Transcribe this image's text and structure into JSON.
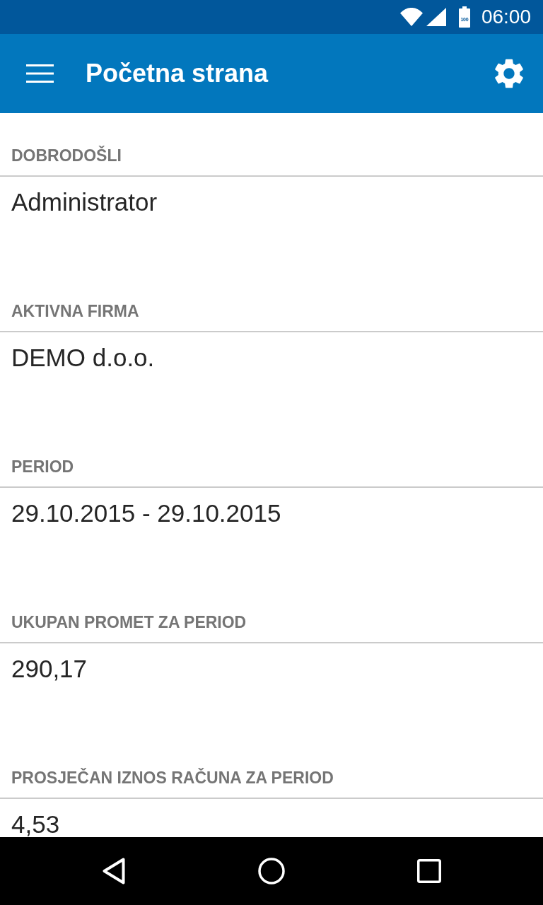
{
  "status_bar": {
    "battery_label": "100",
    "time": "06:00"
  },
  "app_bar": {
    "title": "Početna strana"
  },
  "sections": [
    {
      "heading": "DOBRODOŠLI",
      "value": "Administrator"
    },
    {
      "heading": "AKTIVNA FIRMA",
      "value": "DEMO d.o.o."
    },
    {
      "heading": "PERIOD",
      "value": "29.10.2015 - 29.10.2015"
    },
    {
      "heading": "UKUPAN PROMET ZA PERIOD",
      "value": "290,17"
    },
    {
      "heading": "PROSJEČAN IZNOS RAČUNA ZA PERIOD",
      "value": "4,53"
    }
  ]
}
